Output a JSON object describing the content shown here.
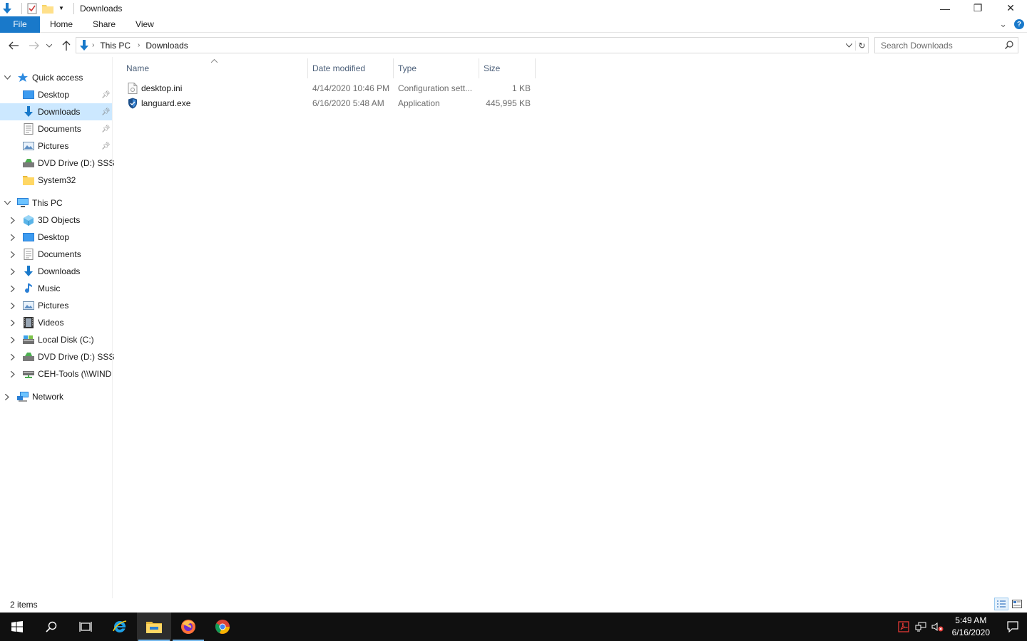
{
  "window": {
    "title": "Downloads",
    "controls": {
      "minimize": "—",
      "restore": "❐",
      "close": "✕"
    }
  },
  "ribbon": {
    "tabs": [
      {
        "label": "File",
        "active": true
      },
      {
        "label": "Home"
      },
      {
        "label": "Share"
      },
      {
        "label": "View"
      }
    ],
    "help": "?",
    "expand": "⌄"
  },
  "address": {
    "crumbs": [
      "This PC",
      "Downloads"
    ],
    "search_placeholder": "Search Downloads"
  },
  "nav": {
    "quick_access": {
      "label": "Quick access",
      "items": [
        {
          "label": "Desktop",
          "icon": "desktop-icon",
          "pinned": true
        },
        {
          "label": "Downloads",
          "icon": "downloads-icon",
          "pinned": true,
          "selected": true
        },
        {
          "label": "Documents",
          "icon": "documents-icon",
          "pinned": true
        },
        {
          "label": "Pictures",
          "icon": "pictures-icon",
          "pinned": true
        },
        {
          "label": "DVD Drive (D:) SSS_",
          "icon": "dvd-drive-icon"
        },
        {
          "label": "System32",
          "icon": "folder-icon"
        }
      ]
    },
    "this_pc": {
      "label": "This PC",
      "items": [
        {
          "label": "3D Objects",
          "icon": "3d-objects-icon"
        },
        {
          "label": "Desktop",
          "icon": "desktop-icon"
        },
        {
          "label": "Documents",
          "icon": "documents-icon"
        },
        {
          "label": "Downloads",
          "icon": "downloads-icon"
        },
        {
          "label": "Music",
          "icon": "music-icon"
        },
        {
          "label": "Pictures",
          "icon": "pictures-icon"
        },
        {
          "label": "Videos",
          "icon": "videos-icon"
        },
        {
          "label": "Local Disk (C:)",
          "icon": "local-disk-icon"
        },
        {
          "label": "DVD Drive (D:) SSS_",
          "icon": "dvd-drive-icon"
        },
        {
          "label": "CEH-Tools (\\\\WIND",
          "icon": "network-drive-icon"
        }
      ]
    },
    "network": {
      "label": "Network"
    }
  },
  "filelist": {
    "columns": {
      "name": "Name",
      "date": "Date modified",
      "type": "Type",
      "size": "Size"
    },
    "rows": [
      {
        "name": "desktop.ini",
        "date": "4/14/2020 10:46 PM",
        "type": "Configuration sett...",
        "size": "1 KB",
        "icon": "config-file-icon"
      },
      {
        "name": "languard.exe",
        "date": "6/16/2020 5:48 AM",
        "type": "Application",
        "size": "445,995 KB",
        "icon": "shield-app-icon"
      }
    ]
  },
  "status": {
    "count": "2 items"
  },
  "taskbar": {
    "time": "5:49 AM",
    "date": "6/16/2020"
  },
  "colors": {
    "accent": "#1979ca",
    "selection": "#cce8ff",
    "taskbar": "#101010"
  }
}
